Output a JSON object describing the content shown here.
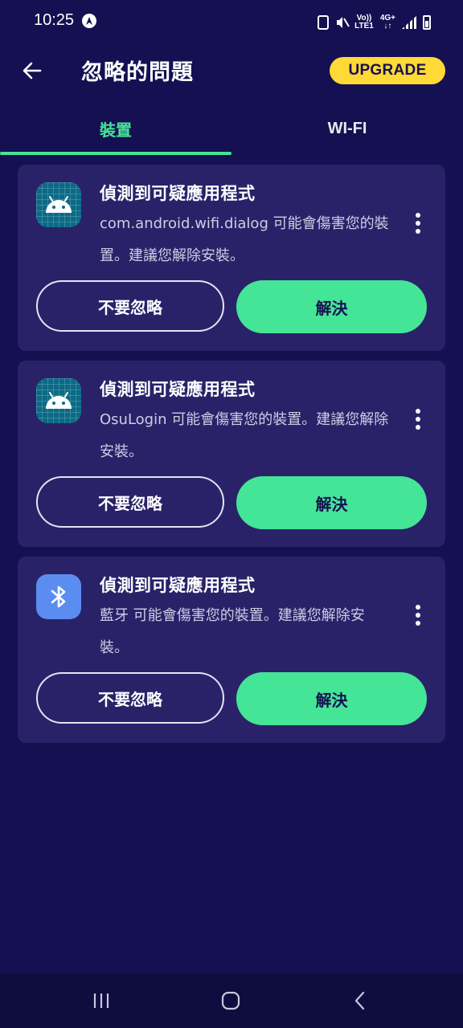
{
  "status_bar": {
    "time": "10:25",
    "network_top": "Vo))",
    "network_bottom": "LTE1",
    "data_top": "4G+",
    "data_bottom": "↓↑",
    "icons": [
      "app-notification-icon",
      "battery-saver-icon",
      "mute-icon",
      "signal-icon",
      "battery-icon"
    ]
  },
  "header": {
    "title": "忽略的問題",
    "upgrade_label": "UPGRADE",
    "back_icon": "arrow-left-icon"
  },
  "tabs": [
    {
      "label": "裝置",
      "active": true
    },
    {
      "label": "WI-FI",
      "active": false
    }
  ],
  "cards": [
    {
      "icon": "android-icon",
      "title": "偵測到可疑應用程式",
      "description": "com.android.wifi.dialog 可能會傷害您的裝置。建議您解除安裝。",
      "ignore_label": "不要忽略",
      "resolve_label": "解決"
    },
    {
      "icon": "android-icon",
      "title": "偵測到可疑應用程式",
      "description": "OsuLogin 可能會傷害您的裝置。建議您解除安裝。",
      "ignore_label": "不要忽略",
      "resolve_label": "解決"
    },
    {
      "icon": "bluetooth-icon",
      "title": "偵測到可疑應用程式",
      "description": "藍牙 可能會傷害您的裝置。建議您解除安裝。",
      "ignore_label": "不要忽略",
      "resolve_label": "解決"
    }
  ],
  "nav_bar": {
    "icons": [
      "recents-icon",
      "home-icon",
      "back-icon"
    ]
  },
  "colors": {
    "background": "#151052",
    "card": "#2a2269",
    "accent_green": "#44e596",
    "upgrade_yellow": "#ffd935",
    "nav_bar": "#0f0c3f"
  }
}
